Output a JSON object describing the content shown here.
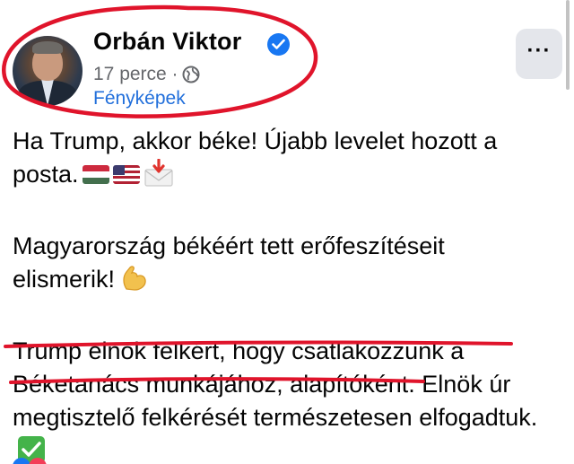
{
  "post": {
    "author": "Orbán Viktor",
    "timestamp": "17 perce ·",
    "album_link": "Fényképek",
    "more_button_label": "···",
    "paragraphs": {
      "p1": "Ha Trump, akkor béke! Újabb levelet hozott a posta.",
      "p2": "Magyarország békéért tett erőfeszítéseit elismerik!",
      "p3": "Trump elnök felkért, hogy csatlakozzunk a Béketanács munkájához, alapítóként. Elnök úr megtisztelő felkérését természetesen elfogadtuk."
    }
  },
  "icons": {
    "verified": "verified-badge-icon",
    "audience": "globe-icon",
    "flags": [
      "hungary-flag-emoji",
      "usa-flag-emoji"
    ],
    "inbox": "incoming-envelope-emoji",
    "flex": "flexed-biceps-emoji",
    "check": "check-mark-button-emoji"
  },
  "colors": {
    "accent_blue": "#1877f2",
    "link_blue": "#216fdb",
    "secondary_text": "#65676b",
    "annotation_red": "#e0142b",
    "button_bg": "#e4e6eb"
  }
}
